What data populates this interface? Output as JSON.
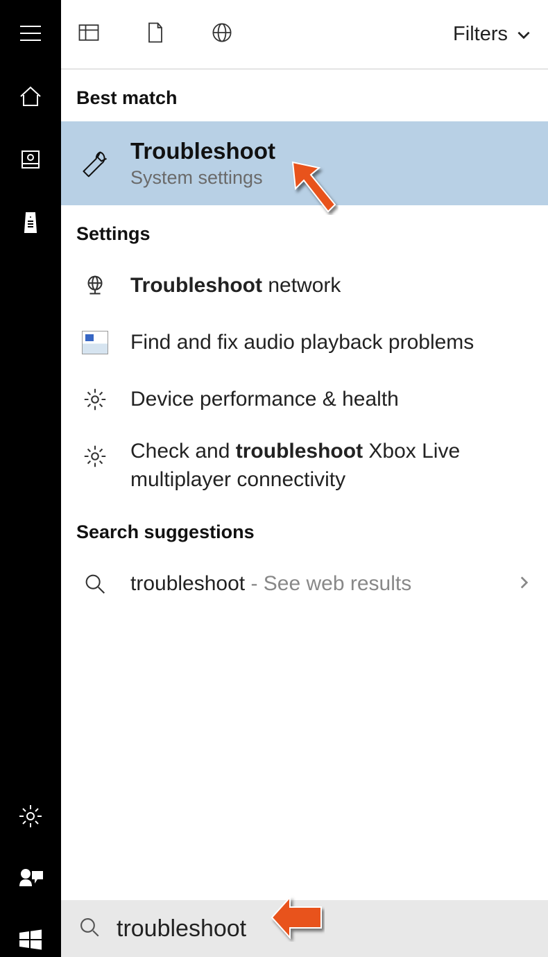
{
  "topbar": {
    "filters_label": "Filters"
  },
  "sections": {
    "best_match": "Best match",
    "settings": "Settings",
    "suggestions": "Search suggestions"
  },
  "best": {
    "title": "Troubleshoot",
    "subtitle": "System settings"
  },
  "settings_items": {
    "network_pre": "Troubleshoot",
    "network_post": " network",
    "audio": "Find and fix audio playback problems",
    "perf": "Device performance & health",
    "xbox_pre": "Check and ",
    "xbox_bold": "troubleshoot",
    "xbox_post": " Xbox Live multiplayer connectivity"
  },
  "suggest": {
    "term": "troubleshoot",
    "hint": " - See web results"
  },
  "search": {
    "value": "troubleshoot"
  }
}
